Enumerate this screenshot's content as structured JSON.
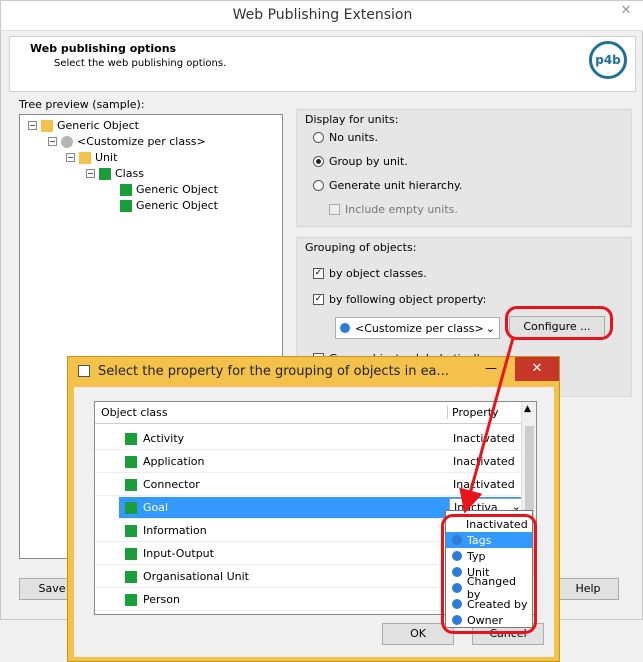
{
  "window": {
    "title": "Web Publishing Extension",
    "close": "✕"
  },
  "header": {
    "title": "Web publishing options",
    "subtitle": "Select the web publishing options.",
    "logo": "p4b"
  },
  "tree": {
    "label": "Tree preview (sample):",
    "nodes": [
      "Generic Object",
      "<Customize per class>",
      "Unit",
      "Class",
      "Generic Object",
      "Generic Object"
    ]
  },
  "display": {
    "group_label": "Display for units:",
    "options": [
      "No units.",
      "Group by unit.",
      "Generate unit hierarchy."
    ],
    "selected": "Group by unit.",
    "include_empty": "Include empty units."
  },
  "grouping": {
    "group_label": "Grouping of objects:",
    "by_classes": "by object classes.",
    "by_property": "by following object property:",
    "property_value": "<Customize per class>",
    "configure": "Configure ...",
    "alphabetic": "Group objects alphabetically"
  },
  "bottom": {
    "save": "Save",
    "help": "Help"
  },
  "dialog": {
    "title": "Select the property for the grouping of objects in ea...",
    "col_class": "Object class",
    "col_property": "Property",
    "rows": [
      {
        "name": "Activity",
        "value": "Inactivated"
      },
      {
        "name": "Application",
        "value": "Inactivated"
      },
      {
        "name": "Connector",
        "value": "Inactivated"
      },
      {
        "name": "Goal",
        "value": "Inactiva"
      },
      {
        "name": "Information",
        "value": ""
      },
      {
        "name": "Input-Output",
        "value": ""
      },
      {
        "name": "Organisational Unit",
        "value": ""
      },
      {
        "name": "Person",
        "value": ""
      }
    ],
    "ok": "OK",
    "cancel": "Cancel"
  },
  "dropdown": {
    "items": [
      "Inactivated",
      "Tags",
      "Typ",
      "Unit",
      "Changed by",
      "Created by",
      "Owner"
    ],
    "selected": "Tags"
  },
  "colors": {
    "annotation": "#e8141c",
    "selection": "#3399ff",
    "dialog_frame": "#f4c14b"
  }
}
